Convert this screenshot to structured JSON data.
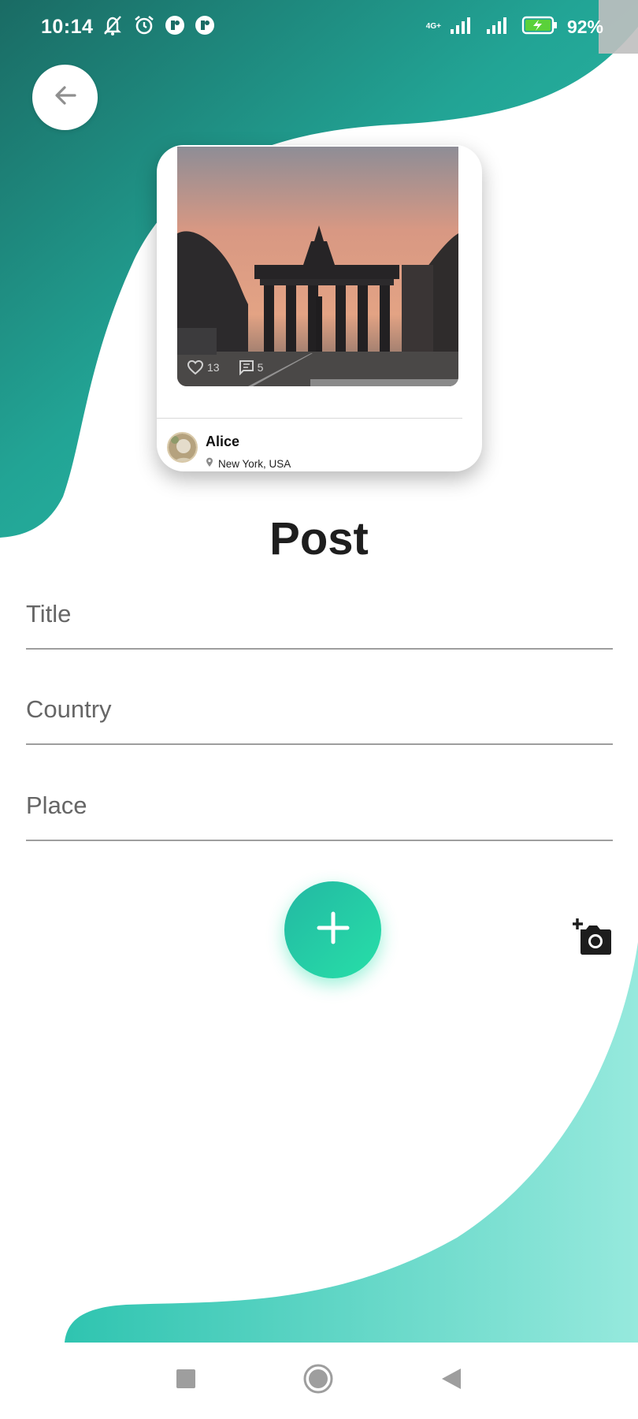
{
  "status_bar": {
    "time": "10:14",
    "network": "4G+",
    "battery_percent": "92%",
    "icons": [
      "notifications-off-icon",
      "alarm-icon",
      "app-icon",
      "app-icon",
      "signal-icon",
      "signal-icon",
      "battery-charging-icon"
    ]
  },
  "back_button": {
    "icon": "arrow-left-icon"
  },
  "post_preview": {
    "likes": "13",
    "comments": "5",
    "author": "Alice",
    "location": "New York, USA",
    "icons": [
      "heart-icon",
      "comment-icon",
      "location-pin-icon"
    ]
  },
  "form": {
    "title": "Post",
    "fields": [
      {
        "placeholder": "Title",
        "value": ""
      },
      {
        "placeholder": "Country",
        "value": ""
      },
      {
        "placeholder": "Place",
        "value": ""
      }
    ],
    "add_button_icon": "plus-icon",
    "camera_button_icon": "add-a-photo-icon"
  },
  "nav_bar": {
    "icons": [
      "recents-square-icon",
      "home-circle-icon",
      "back-triangle-icon"
    ]
  },
  "colors": {
    "accent": "#26C2A6",
    "accent_light": "#8FE6D9",
    "gradient_start": "#1B6E66",
    "add_button": "#27DFA8"
  }
}
